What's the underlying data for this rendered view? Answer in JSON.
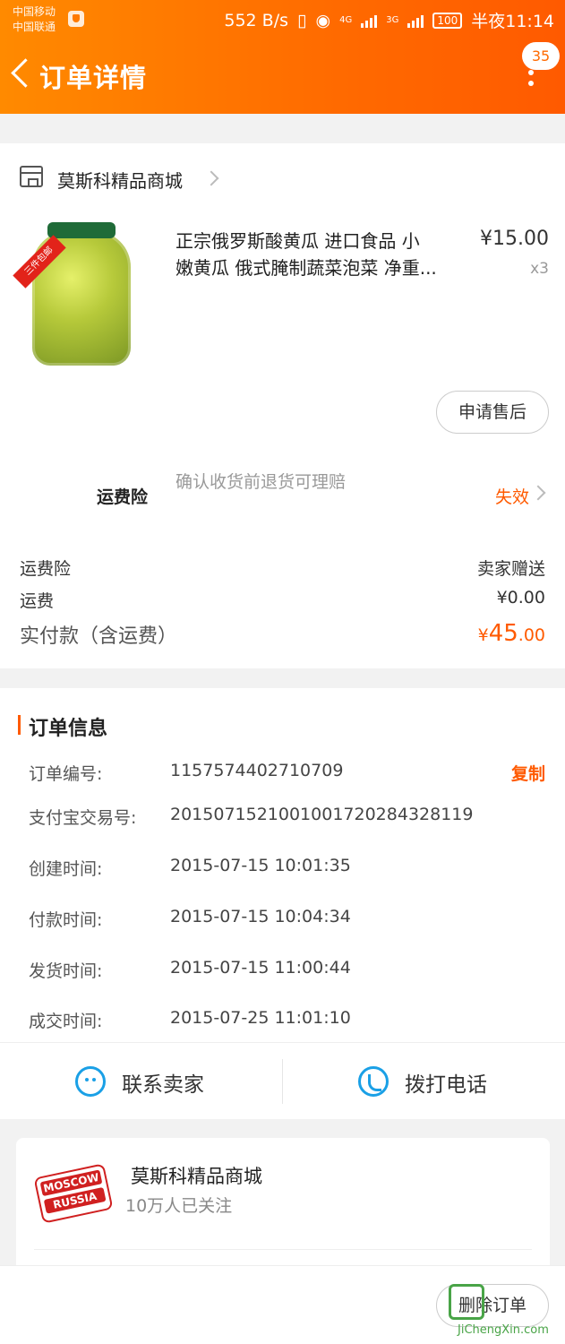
{
  "status_bar": {
    "carrier_1": "中国移动",
    "carrier_2": "中国联通",
    "speed": "552 B/s",
    "network_1": "4G",
    "network_2": "3G",
    "battery": "100",
    "time": "半夜11:14"
  },
  "nav": {
    "title": "订单详情",
    "badge_count": "35"
  },
  "shop": {
    "name": "莫斯科精品商城"
  },
  "product": {
    "title_line_1": "正宗俄罗斯酸黄瓜 进口食品 小",
    "title_line_2": "嫩黄瓜 俄式腌制蔬菜泡菜 净重...",
    "price": "¥15.00",
    "quantity": "x3",
    "badge": "三件包邮"
  },
  "aftersale_button": "申请售后",
  "insurance": {
    "label": "运费险",
    "description": "确认收货前退货可理赔",
    "status": "失效"
  },
  "summary": {
    "insurance_label": "运费险",
    "insurance_value": "卖家赠送",
    "shipping_label": "运费",
    "shipping_value": "¥0.00",
    "total_label": "实付款（含运费）",
    "total_currency": "¥",
    "total_int": "45",
    "total_dec": ".00"
  },
  "order_info": {
    "title": "订单信息",
    "copy_label": "复制",
    "rows": [
      {
        "label": "订单编号:",
        "value": "1157574402710709"
      },
      {
        "label": "支付宝交易号:",
        "value": "2015071521001001720284328119"
      },
      {
        "label": "创建时间:",
        "value": "2015-07-15 10:01:35"
      },
      {
        "label": "付款时间:",
        "value": "2015-07-15 10:04:34"
      },
      {
        "label": "发货时间:",
        "value": "2015-07-15 11:00:44"
      },
      {
        "label": "成交时间:",
        "value": "2015-07-25 11:01:10"
      }
    ]
  },
  "actions": {
    "contact_seller": "联系卖家",
    "call": "拨打电话"
  },
  "store_card": {
    "name": "莫斯科精品商城",
    "followers": "10万人已关注",
    "logo_text_1": "MOSCOW",
    "logo_text_2": "RUSSIA"
  },
  "bottom": {
    "delete_order": "删除订单",
    "watermark": "JiChengXin.com"
  },
  "colors": {
    "brand_orange": "#ff6a00",
    "accent_blue": "#1aa0e6"
  }
}
